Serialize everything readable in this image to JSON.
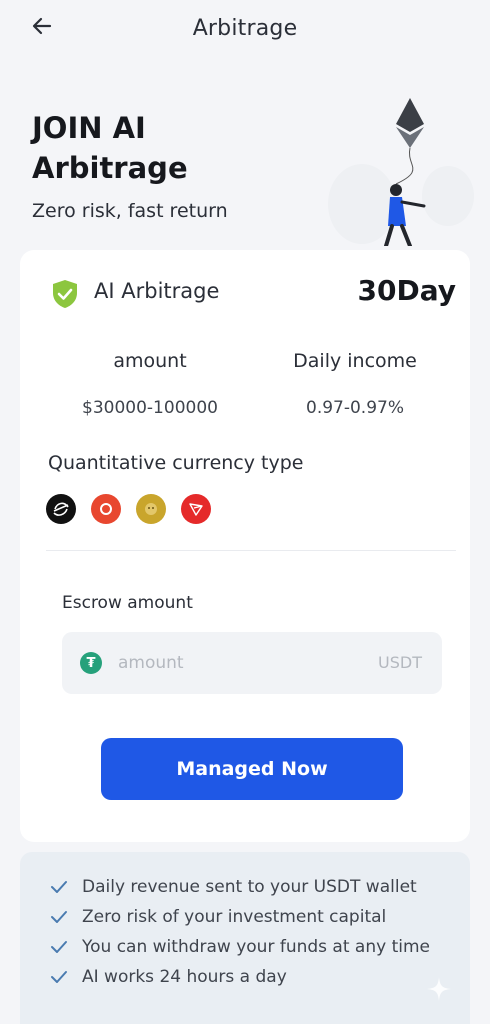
{
  "header": {
    "title": "Arbitrage",
    "back_icon": "arrow-left-icon"
  },
  "hero": {
    "title": "JOIN AI Arbitrage",
    "subtitle": "Zero risk, fast return",
    "illustration": "person-holding-ethereum-balloon"
  },
  "plan": {
    "icon": "shield-check-icon",
    "name": "AI Arbitrage",
    "duration": "30Day",
    "amount_label": "amount",
    "amount_value": "$30000-100000",
    "income_label": "Daily income",
    "income_value": "0.97-0.97%",
    "currency_title": "Quantitative currency type",
    "currencies": [
      {
        "icon": "stellar-coin-icon",
        "color": "#111111"
      },
      {
        "icon": "red-coin-icon",
        "color": "#e8472f"
      },
      {
        "icon": "doge-coin-icon",
        "color": "#c9a52c"
      },
      {
        "icon": "tron-coin-icon",
        "color": "#e52a2a"
      }
    ]
  },
  "escrow": {
    "label": "Escrow amount",
    "placeholder": "amount",
    "value": "",
    "unit": "USDT",
    "icon": "tether-icon"
  },
  "cta": {
    "label": "Managed Now",
    "color": "#1f58e6"
  },
  "benefits": [
    "Daily revenue sent to your USDT wallet",
    "Zero risk of your investment capital",
    "You can withdraw your funds at any time",
    "AI works 24 hours a day"
  ],
  "colors": {
    "accent": "#1f58e6",
    "shield": "#8cc63f",
    "check": "#4a7bb0",
    "tether": "#26a17b"
  }
}
